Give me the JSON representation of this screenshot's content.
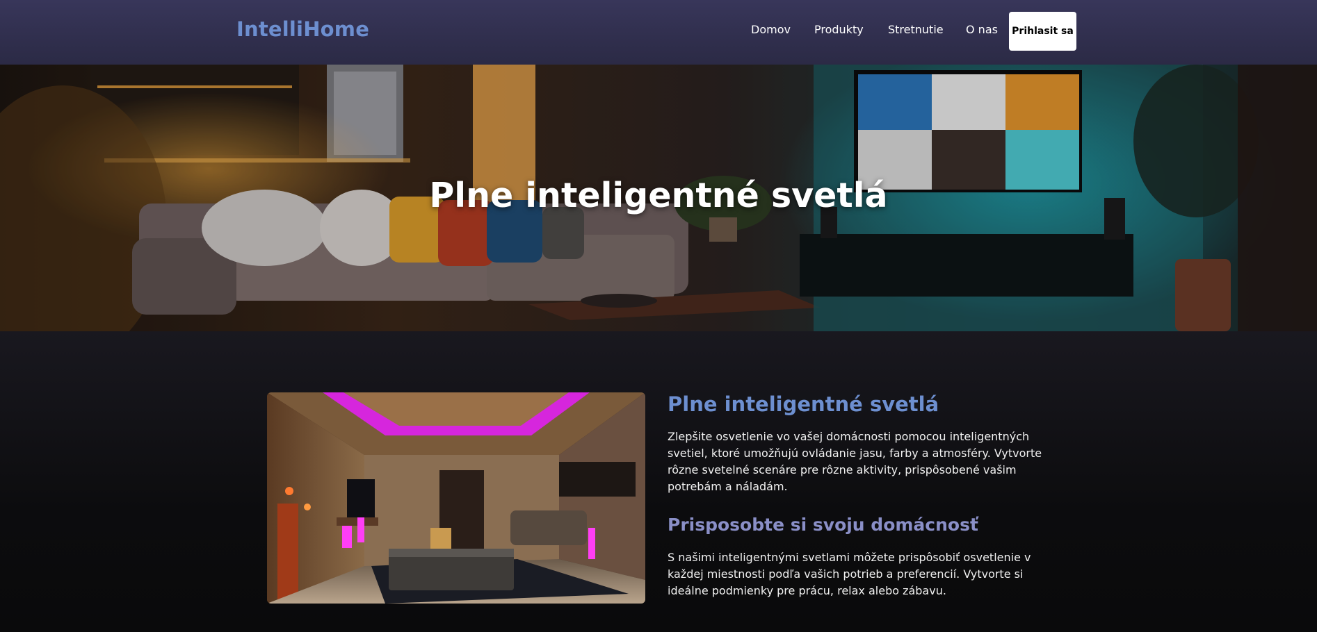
{
  "nav": {
    "logo": "IntelliHome",
    "links": [
      "Domov",
      "Produkty",
      "Stretnutie",
      "O nas"
    ],
    "login": "Prihlasit sa"
  },
  "hero": {
    "title": "Plne inteligentné svetlá"
  },
  "section": {
    "title": "Plne inteligentné svetlá",
    "text": "Zlepšite osvetlenie vo vašej domácnosti pomocou inteligentných svetiel, ktoré umožňujú ovládanie jasu, farby a atmosféry. Vytvorte rôzne svetelné scenáre pre rôzne aktivity, prispôsobené vašim potrebám a náladám.",
    "subtitle": "Prisposobte si svoju domácnosť",
    "subtext": "S našimi inteligentnými svetlami môžete prispôsobiť osvetlenie v každej miestnosti podľa vašich potrieb a preferencií. Vytvorte si ideálne podmienky pre prácu, relax alebo zábavu."
  },
  "colors": {
    "brand": "#6d8fd0",
    "subtitle": "#8a8fc7",
    "nav_bg": "#2b2a45",
    "accent_neon": "#e020f0"
  }
}
